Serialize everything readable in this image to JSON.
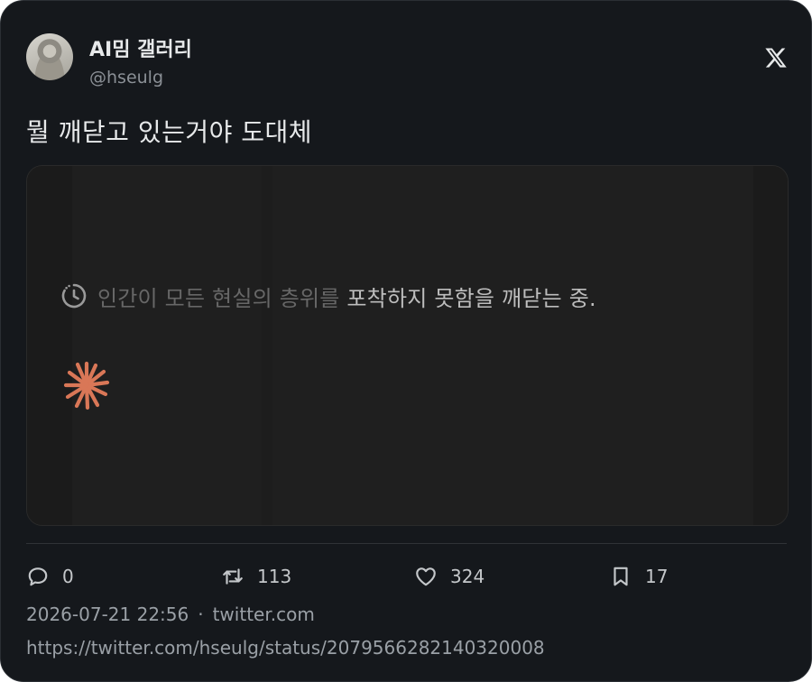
{
  "author": {
    "display_name": "AI밈 갤러리",
    "handle": "@hseulg",
    "avatar_icon": "avatar-robot"
  },
  "brand": {
    "logo": "x-logo-icon"
  },
  "tweet": {
    "text": "뭘 깨닫고 있는거야 도대체"
  },
  "media": {
    "status_dim": "인간이 모든 현실의 층위를 ",
    "status_bright": "포착하지 못함을 깨닫는 중.",
    "status_icon": "clock-icon",
    "spinner_icon": "spark-icon",
    "accent_color": "#d97757"
  },
  "actions": {
    "replies": "0",
    "retweets": "113",
    "likes": "324",
    "bookmarks": "17"
  },
  "meta": {
    "timestamp": "2026-07-21 22:56",
    "separator": "·",
    "source": "twitter.com",
    "url": "https://twitter.com/hseulg/status/2079566282140320008"
  }
}
